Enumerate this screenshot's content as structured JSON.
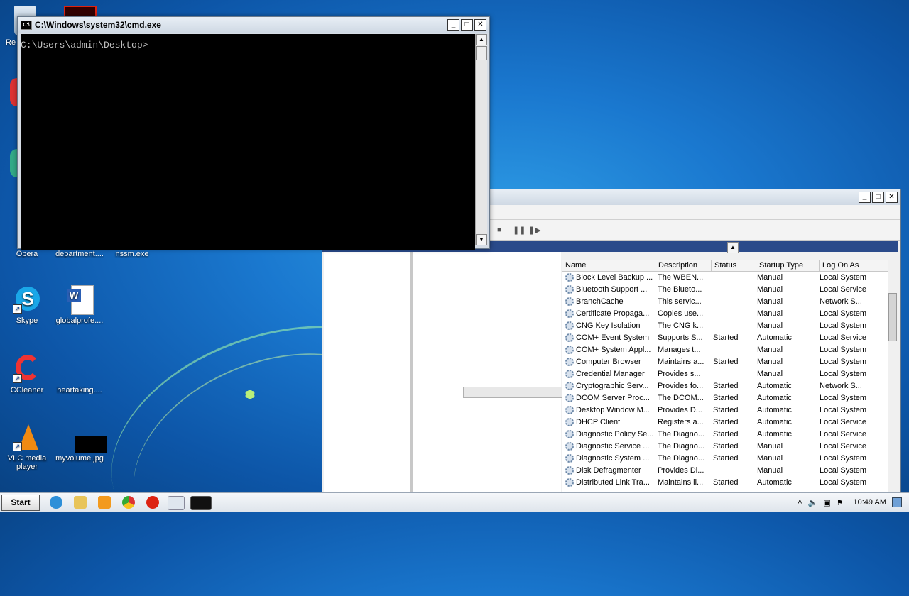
{
  "desktop": {
    "icons": [
      {
        "label": "Re",
        "name": "recycle-bin-icon"
      },
      {
        "label": "Opera",
        "name": "opera-icon"
      },
      {
        "label": "department....",
        "name": "department-file-icon"
      },
      {
        "label": "nssm.exe",
        "name": "nssm-exe-icon"
      },
      {
        "label": "Skype",
        "name": "skype-icon"
      },
      {
        "label": "globalprofe....",
        "name": "word-doc-icon"
      },
      {
        "label": "CCleaner",
        "name": "ccleaner-icon"
      },
      {
        "label": "heartaking....",
        "name": "heartaking-file-icon"
      },
      {
        "label": "VLC media player",
        "name": "vlc-icon"
      },
      {
        "label": "myvolume.jpg",
        "name": "myvolume-image-icon"
      }
    ]
  },
  "cmd": {
    "title": "C:\\Windows\\system32\\cmd.exe",
    "prompt": "C:\\Users\\admin\\Desktop>",
    "buttons": {
      "min": "_",
      "max": "□",
      "close": "✕"
    }
  },
  "services": {
    "columns": [
      "Name",
      "Description",
      "Status",
      "Startup Type",
      "Log On As"
    ],
    "rows": [
      [
        "Block Level Backup ...",
        "The WBEN...",
        "",
        "Manual",
        "Local System"
      ],
      [
        "Bluetooth Support ...",
        "The Blueto...",
        "",
        "Manual",
        "Local Service"
      ],
      [
        "BranchCache",
        "This servic...",
        "",
        "Manual",
        "Network S..."
      ],
      [
        "Certificate Propaga...",
        "Copies use...",
        "",
        "Manual",
        "Local System"
      ],
      [
        "CNG Key Isolation",
        "The CNG k...",
        "",
        "Manual",
        "Local System"
      ],
      [
        "COM+ Event System",
        "Supports S...",
        "Started",
        "Automatic",
        "Local Service"
      ],
      [
        "COM+ System Appl...",
        "Manages t...",
        "",
        "Manual",
        "Local System"
      ],
      [
        "Computer Browser",
        "Maintains a...",
        "Started",
        "Manual",
        "Local System"
      ],
      [
        "Credential Manager",
        "Provides s...",
        "",
        "Manual",
        "Local System"
      ],
      [
        "Cryptographic Serv...",
        "Provides fo...",
        "Started",
        "Automatic",
        "Network S..."
      ],
      [
        "DCOM Server Proc...",
        "The DCOM...",
        "Started",
        "Automatic",
        "Local System"
      ],
      [
        "Desktop Window M...",
        "Provides D...",
        "Started",
        "Automatic",
        "Local System"
      ],
      [
        "DHCP Client",
        "Registers a...",
        "Started",
        "Automatic",
        "Local Service"
      ],
      [
        "Diagnostic Policy Se...",
        "The Diagno...",
        "Started",
        "Automatic",
        "Local Service"
      ],
      [
        "Diagnostic Service ...",
        "The Diagno...",
        "Started",
        "Manual",
        "Local Service"
      ],
      [
        "Diagnostic System ...",
        "The Diagno...",
        "Started",
        "Manual",
        "Local System"
      ],
      [
        "Disk Defragmenter",
        "Provides Di...",
        "",
        "Manual",
        "Local System"
      ],
      [
        "Distributed Link Tra...",
        "Maintains li...",
        "Started",
        "Automatic",
        "Local System"
      ]
    ]
  },
  "taskbar": {
    "start_label": "Start",
    "clock": "10:49 AM"
  }
}
